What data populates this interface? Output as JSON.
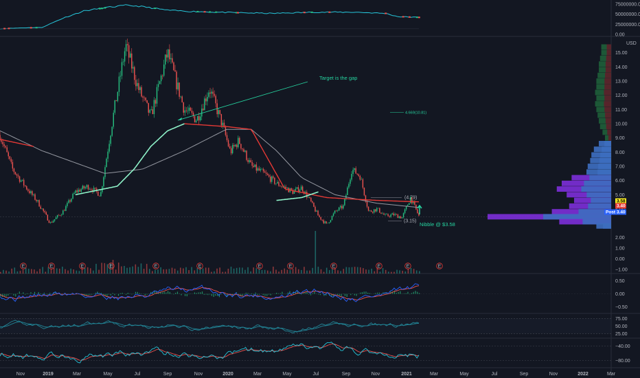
{
  "chart_data": {
    "type": "line",
    "currency": "USD",
    "panes": [
      "volume-trend",
      "price",
      "volume",
      "macd",
      "rsi",
      "stochastic"
    ],
    "x_ticks": [
      "Nov",
      "2019",
      "Mar",
      "May",
      "Jul",
      "Sep",
      "Nov",
      "2020",
      "Mar",
      "May",
      "Jul",
      "Sep",
      "Nov",
      "2021",
      "Mar",
      "May",
      "Jul",
      "Sep",
      "Nov",
      "2022",
      "Mar"
    ],
    "price_axis": {
      "ticks": [
        "15.00",
        "14.00",
        "13.00",
        "12.00",
        "11.00",
        "10.00",
        "9.00",
        "8.00",
        "7.00",
        "6.00",
        "5.00",
        "4.00"
      ],
      "ylim": [
        2.5,
        16
      ],
      "badges": [
        {
          "label": "3.58",
          "value": 3.58,
          "bg": "#f5ea24",
          "fg": "#000000"
        },
        {
          "label": "3.40",
          "value": 3.4,
          "bg": "#e53935",
          "fg": "#ffffff"
        },
        {
          "label": "Post",
          "value": 3.4,
          "bg": "#2962ff",
          "fg": "#ffffff"
        },
        {
          "label": "3.40",
          "value": 3.4,
          "bg": "#2962ff",
          "fg": "#ffffff"
        }
      ]
    },
    "volume_trend_axis": {
      "ticks": [
        "75000000.00",
        "50000000.00",
        "25000000.00",
        "0.00"
      ],
      "ylim": [
        0,
        75000000
      ]
    },
    "volume_axis": {
      "ticks": [
        "2.00",
        "1.00",
        "0.00",
        "−1.00"
      ],
      "ylim": [
        -1.4,
        2.6
      ]
    },
    "macd_axis": {
      "ticks": [
        "0.50",
        "0.00",
        "−0.50"
      ],
      "ylim": [
        -0.75,
        0.75
      ]
    },
    "rsi_axis": {
      "ticks": [
        "75.00",
        "50.00",
        "25.00"
      ],
      "ylim": [
        10,
        90
      ]
    },
    "stoch_axis": {
      "ticks": [
        "−40.00",
        "−80.00"
      ],
      "ylim": [
        -100,
        -20
      ]
    },
    "price_series": {
      "name": "Close",
      "x": [
        0,
        0.03,
        0.06,
        0.09,
        0.12,
        0.15,
        0.18,
        0.21,
        0.24,
        0.27,
        0.3,
        0.33,
        0.36,
        0.4,
        0.44,
        0.47,
        0.5,
        0.53,
        0.55,
        0.57,
        0.6,
        0.63,
        0.66,
        0.7,
        0.72,
        0.74,
        0.76,
        0.78,
        0.8,
        0.82,
        0.84,
        0.86,
        0.88,
        0.9,
        0.92,
        0.94,
        0.96,
        0.98,
        1.0
      ],
      "y": [
        9.2,
        6.8,
        5.6,
        4.5,
        3.0,
        3.8,
        5.2,
        5.6,
        5.0,
        10.5,
        15.5,
        12.5,
        10.5,
        15.0,
        11.0,
        10.3,
        12.5,
        10.0,
        8.0,
        8.8,
        7.0,
        6.5,
        5.8,
        5.2,
        5.5,
        4.6,
        3.5,
        2.9,
        3.8,
        4.2,
        6.8,
        6.3,
        3.8,
        4.0,
        3.5,
        3.6,
        3.4,
        4.8,
        3.5
      ]
    },
    "ma_red": {
      "x": [
        0.0,
        0.08,
        0.44,
        0.54,
        0.6,
        0.68,
        0.78,
        0.9,
        1.0
      ],
      "y": [
        8.9,
        8.4,
        10.0,
        9.8,
        9.6,
        5.4,
        4.8,
        4.6,
        4.5
      ]
    },
    "ma_green": {
      "x": [
        0.18,
        0.23,
        0.28,
        0.32,
        0.36,
        0.4,
        0.44,
        0.66,
        0.72,
        0.76
      ],
      "y": [
        5.0,
        5.3,
        5.6,
        6.8,
        8.4,
        9.5,
        10.0,
        4.6,
        4.8,
        5.2
      ]
    },
    "ma_white": {
      "x": [
        0,
        0.1,
        0.25,
        0.34,
        0.44,
        0.54,
        0.6,
        0.66,
        0.72,
        0.8,
        0.9,
        1.0
      ],
      "y": [
        9.5,
        8.1,
        6.5,
        6.8,
        8.1,
        9.6,
        9.6,
        8.1,
        6.2,
        5.0,
        4.4,
        4.1
      ]
    },
    "levels": [
      {
        "label": "(4.79)",
        "value": 4.79
      },
      {
        "label": "4.669(10.81)",
        "value": 10.81
      },
      {
        "label": "(3.15)",
        "value": 3.15
      }
    ],
    "annotations": [
      {
        "text": "Target is the gap",
        "value": 10.1
      },
      {
        "text": "Nibble @ $3.58",
        "value": 3.58
      }
    ],
    "earnings_markers": [
      "E",
      "E",
      "E",
      "E",
      "E",
      "E",
      "E",
      "E",
      "E",
      "E",
      "E",
      "E"
    ],
    "volume_profile": [
      {
        "price": 15.4,
        "value": 0.08,
        "color": "#1e5e3a"
      },
      {
        "price": 15.0,
        "value": 0.08,
        "color": "#1e5e3a"
      },
      {
        "price": 14.6,
        "value": 0.09,
        "color": "#1e5e3a"
      },
      {
        "price": 14.2,
        "value": 0.1,
        "color": "#1e5e3a"
      },
      {
        "price": 13.8,
        "value": 0.1,
        "color": "#1e5e3a"
      },
      {
        "price": 13.4,
        "value": 0.11,
        "color": "#1e5e3a"
      },
      {
        "price": 13.0,
        "value": 0.12,
        "color": "#1e5e3a"
      },
      {
        "price": 12.6,
        "value": 0.12,
        "color": "#1e5e3a"
      },
      {
        "price": 12.2,
        "value": 0.13,
        "color": "#1e5e3a"
      },
      {
        "price": 11.8,
        "value": 0.12,
        "color": "#1e5e3a"
      },
      {
        "price": 11.4,
        "value": 0.13,
        "color": "#1e5e3a"
      },
      {
        "price": 11.0,
        "value": 0.12,
        "color": "#1e5e3a"
      },
      {
        "price": 10.6,
        "value": 0.11,
        "color": "#1e5e3a"
      },
      {
        "price": 10.2,
        "value": 0.1,
        "color": "#1e5e3a"
      },
      {
        "price": 9.8,
        "value": 0.09,
        "color": "#1e5e3a"
      },
      {
        "price": 9.4,
        "value": 0.07,
        "color": "#1e5e3a"
      },
      {
        "price": 9.0,
        "value": 0.05,
        "color": "#1e5e3a"
      },
      {
        "price": 8.6,
        "value": 0.1,
        "color": "#3d6ebf"
      },
      {
        "price": 8.2,
        "value": 0.14,
        "color": "#3d6ebf"
      },
      {
        "price": 7.8,
        "value": 0.16,
        "color": "#3d6ebf"
      },
      {
        "price": 7.4,
        "value": 0.17,
        "color": "#3d6ebf"
      },
      {
        "price": 7.0,
        "value": 0.19,
        "color": "#3d6ebf"
      },
      {
        "price": 6.6,
        "value": 0.2,
        "color": "#3d6ebf"
      },
      {
        "price": 6.2,
        "value": 0.32,
        "color": "#7b2fd6"
      },
      {
        "price": 5.8,
        "value": 0.4,
        "color": "#7b2fd6"
      },
      {
        "price": 5.4,
        "value": 0.44,
        "color": "#7b2fd6"
      },
      {
        "price": 5.0,
        "value": 0.36,
        "color": "#7b2fd6"
      },
      {
        "price": 4.6,
        "value": 0.3,
        "color": "#7b2fd6"
      },
      {
        "price": 4.2,
        "value": 0.34,
        "color": "#7b2fd6"
      },
      {
        "price": 3.8,
        "value": 0.48,
        "color": "#7b2fd6"
      },
      {
        "price": 3.45,
        "value": 1.0,
        "color": "#7b2fd6"
      },
      {
        "price": 3.1,
        "value": 0.42,
        "color": "#7b2fd6"
      },
      {
        "price": 2.8,
        "value": 0.12,
        "color": "#3d6ebf"
      }
    ],
    "colors": {
      "up": "#26a69a",
      "down": "#ef5350",
      "accent_green": "#26d4a0",
      "ma_red": "#e53935",
      "ma_white": "#9598a1",
      "background": "#131722"
    }
  }
}
